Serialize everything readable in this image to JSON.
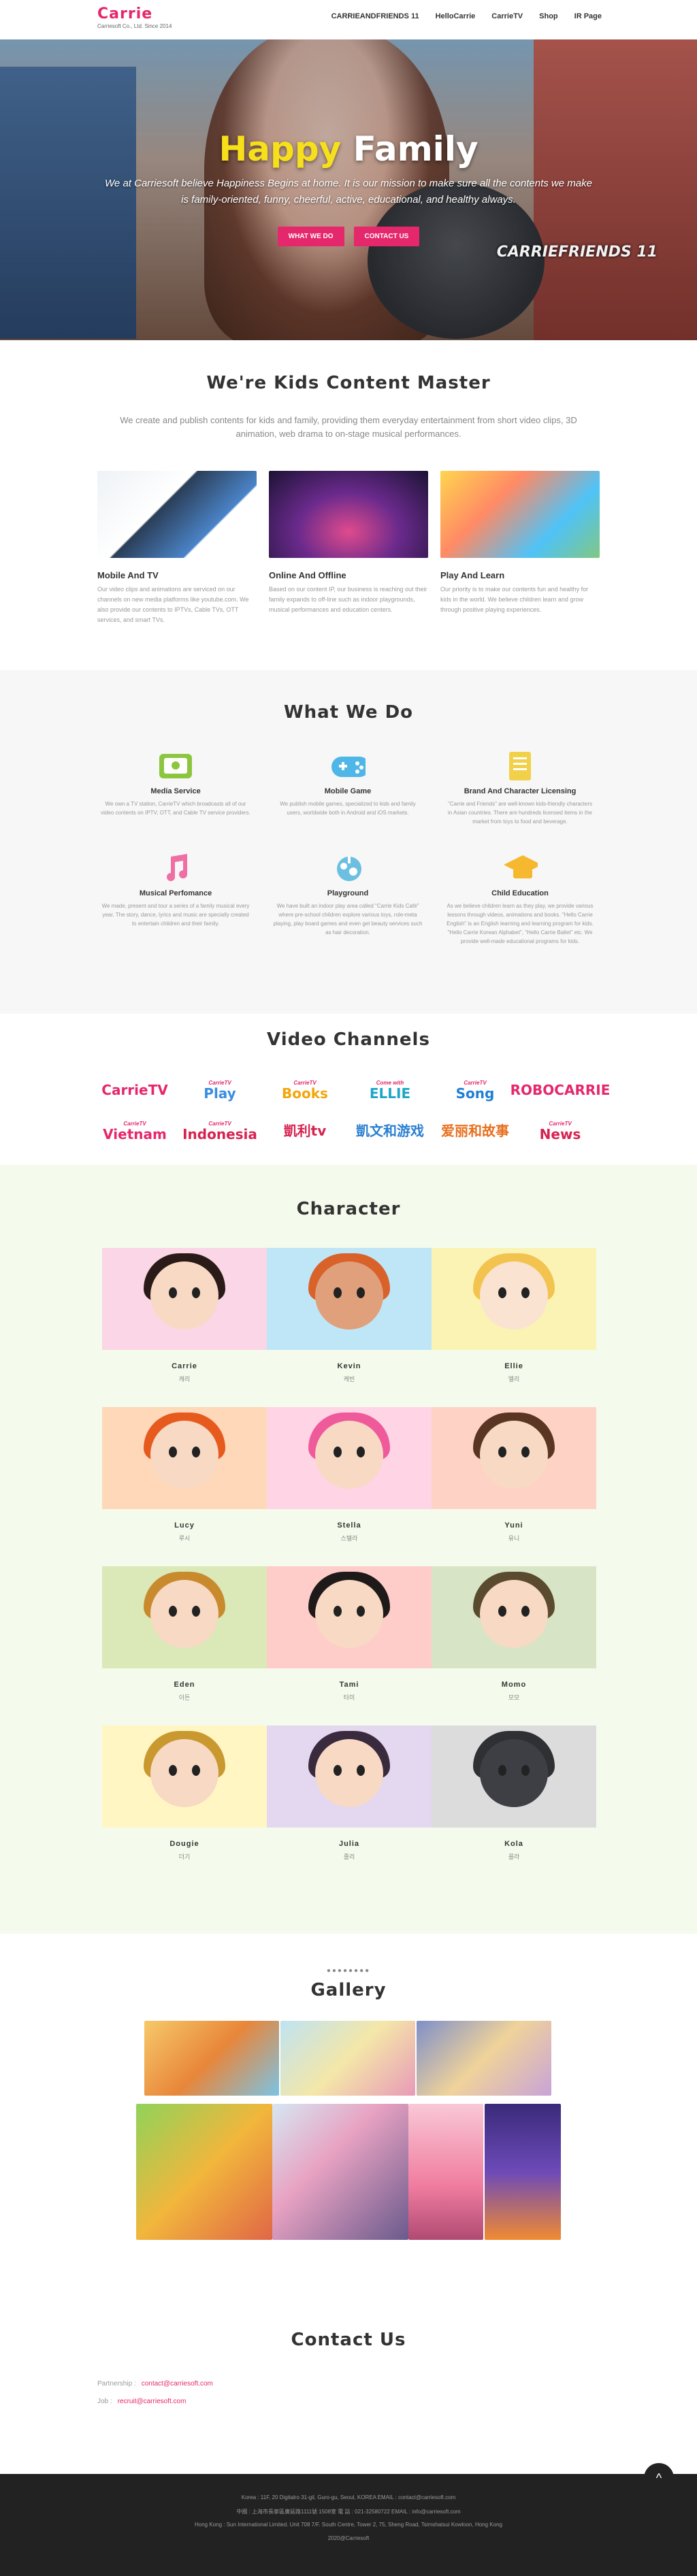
{
  "header": {
    "logo": "Carrie",
    "logo_sub": "Carriesoft Co., Ltd. Since 2014",
    "nav": [
      "CARRIEANDFRIENDS 11",
      "HelloCarrie",
      "CarrieTV",
      "Shop",
      "IR Page"
    ]
  },
  "hero": {
    "title_highlight": "Happy",
    "title_rest": " Family",
    "text": "We at Carriesoft believe Happiness Begins at home. It is our mission to make sure all the contents we make is family-oriented, funny, cheerful, active, educational, and healthy always.",
    "btn_what": "WHAT WE DO",
    "btn_contact": "CONTACT US",
    "brand": "CARRIEFRIENDS 11"
  },
  "intro": {
    "title": "We're Kids Content Master",
    "text": "We create and publish contents for kids and family, providing them everyday entertainment from short video clips, 3D animation, web drama to on-stage musical performances.",
    "features": [
      {
        "title": "Mobile And TV",
        "text": "Our video clips and animations are serviced on our channels on new media platforms like youtube.com. We also provide our contents to IPTVs, Cable TVs, OTT services, and smart TVs."
      },
      {
        "title": "Online And Offline",
        "text": "Based on our content IP, our business is reaching out their family expands to off-line such as indoor playgrounds, musical performances and education centers."
      },
      {
        "title": "Play And Learn",
        "text": "Our priority is to make our contents fun and healthy for kids in the world. We believe children learn and grow through positive playing experiences."
      }
    ]
  },
  "whatwedo": {
    "title": "What We Do",
    "services": [
      {
        "icon": "tv-icon",
        "title": "Media Service",
        "text": "We own a TV station, CarrieTV which broadcasts all of our video contents on IPTV, OTT, and Cable TV service providers."
      },
      {
        "icon": "gamepad-icon",
        "title": "Mobile Game",
        "text": "We publish mobile games, specialized to kids and family users, worldwide both in Android and iOS markets."
      },
      {
        "icon": "license-icon",
        "title": "Brand And Character Licensing",
        "text": "\"Carrie and Friends\" are well-known kids-friendly characters in Asian countries. There are hundreds licensed items in the market from toys to food and beverage."
      },
      {
        "icon": "music-icon",
        "title": "Musical Perfomance",
        "text": "We made, present and tour a series of a family musical every year. The story, dance, lyrics and music are specially created to entertain children and their family."
      },
      {
        "icon": "playground-icon",
        "title": "Playground",
        "text": "We have built an indoor play area called \"Carrie Kids Café\" where pre-school children explore various toys, role-meta playing, play board games and even get beauty services such as hair decoration."
      },
      {
        "icon": "graduation-cap-icon",
        "title": "Child Education",
        "text": "As we believe children learn as they play, we provide various lessons through videos, animations and books. \"Hello Carrie English\" is an English learning and learning program for kids. \"Hello Carrie Korean Alphabet\", \"Hello Carrie Ballet\" etc. We provide well-made educational programs for kids."
      }
    ]
  },
  "channels": {
    "title": "Video Channels",
    "items": [
      {
        "top": "",
        "main": "CarrieTV",
        "color": "#e5276b"
      },
      {
        "top": "CarrieTV",
        "main": "Play",
        "color": "#3a8de0"
      },
      {
        "top": "CarrieTV",
        "main": "Books",
        "color": "#f2a60c"
      },
      {
        "top": "Come with",
        "main": "ELLIE",
        "color": "#1ea6c9"
      },
      {
        "top": "CarrieTV",
        "main": "Song",
        "color": "#1e7fd6"
      },
      {
        "top": "",
        "main": "ROBOCARRIE",
        "color": "#e5276b"
      },
      {
        "top": "CarrieTV",
        "main": "Vietnam",
        "color": "#e5276b"
      },
      {
        "top": "CarrieTV",
        "main": "Indonesia",
        "color": "#d6224f"
      },
      {
        "top": "",
        "main": "凱利tv",
        "color": "#d6224f"
      },
      {
        "top": "",
        "main": "凱文和游戏",
        "color": "#2a7fd0"
      },
      {
        "top": "",
        "main": "爱丽和故事",
        "color": "#e86f1e"
      },
      {
        "top": "CarrieTV",
        "main": "News",
        "color": "#d6224f"
      }
    ]
  },
  "character": {
    "title": "Character",
    "items": [
      {
        "name": "Carrie",
        "kname": "캐리",
        "bg": "#fbd6e6",
        "skin": "#f7d9c4",
        "hair": "#2a1b18"
      },
      {
        "name": "Kevin",
        "kname": "케빈",
        "bg": "#bfe6f6",
        "skin": "#e0a07c",
        "hair": "#d9622b"
      },
      {
        "name": "Ellie",
        "kname": "엘리",
        "bg": "#fbf3b4",
        "skin": "#fbe3d2",
        "hair": "#f2c34e"
      },
      {
        "name": "Lucy",
        "kname": "루시",
        "bg": "#ffd8b9",
        "skin": "#f7d9c4",
        "hair": "#e65a1e"
      },
      {
        "name": "Stella",
        "kname": "스텔라",
        "bg": "#ffd4e4",
        "skin": "#f7d9c4",
        "hair": "#ef5a9b"
      },
      {
        "name": "Yuni",
        "kname": "유니",
        "bg": "#ffd2c6",
        "skin": "#f7d9c4",
        "hair": "#5a3524"
      },
      {
        "name": "Eden",
        "kname": "이든",
        "bg": "#dbe9b8",
        "skin": "#f7d9c4",
        "hair": "#c98a2e"
      },
      {
        "name": "Tami",
        "kname": "타미",
        "bg": "#ffcdc9",
        "skin": "#f7d9c4",
        "hair": "#1e1a1a"
      },
      {
        "name": "Momo",
        "kname": "모모",
        "bg": "#d7e4c6",
        "skin": "#f7d9c4",
        "hair": "#5a4a2e"
      },
      {
        "name": "Dougie",
        "kname": "더기",
        "bg": "#fff6c4",
        "skin": "#f7d9c4",
        "hair": "#c9982e"
      },
      {
        "name": "Julia",
        "kname": "줄리",
        "bg": "#e3d8ef",
        "skin": "#f7d9c4",
        "hair": "#3a2a3e"
      },
      {
        "name": "Kola",
        "kname": "콜라",
        "bg": "#dcdcdc",
        "skin": "#3e3f44",
        "hair": "#2f3034"
      }
    ]
  },
  "gallery": {
    "dots": "●●●●●●●●",
    "title": "Gallery"
  },
  "contact": {
    "title": "Contact Us",
    "partnership_label": "Partnership :",
    "partnership_mail": "contact@carriesoft.com",
    "job_label": "Job :",
    "job_mail": "recruit@carriesoft.com"
  },
  "footer": {
    "line1": "Korea : 11F, 20 Digitalro 31-gil, Guro-gu, Seoul, KOREA EMAIL : contact@carriesoft.com",
    "line2": "中國 : 上海市長寧區廣延路1111號 1508室 電 話 : 021-32580722 EMAIL : info@carriesoft.com",
    "line3": "Hong Kong : Sun International Limited. Unit 708 7/F. South Centre, Tower 2, 75, Sheng Road, Tsimshatsui Kowloon, Hong Kong",
    "copyright": "2020@Carriesoft",
    "totop": "^"
  }
}
